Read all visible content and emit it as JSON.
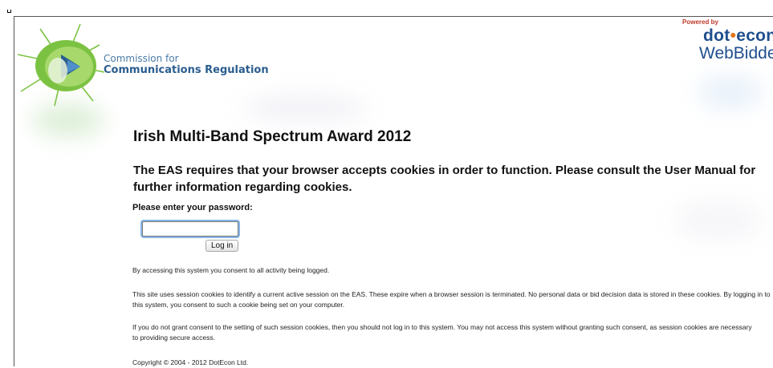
{
  "org": {
    "line1": "Commission for",
    "line2": "Communications Regulation"
  },
  "brand": {
    "powered_by": "Powered by",
    "dot": "dot",
    "econ": "econ",
    "webbidder": "WebBidder"
  },
  "page": {
    "title": "Irish Multi-Band Spectrum Award 2012",
    "cookie_notice": "The EAS requires that your browser accepts cookies in order to function. Please consult the User Manual for further information regarding cookies."
  },
  "form": {
    "password_label": "Please enter your password:",
    "password_value": "",
    "login_label": "Log in"
  },
  "notices": {
    "logging": "By accessing this system you consent to all activity being logged.",
    "session_cookies": "This site uses session cookies to identify a current active session on the EAS. These expire when a browser session is terminated. No personal data or bid decision data is stored in these cookies. By logging in to this system, you consent to such a cookie being set on your computer.",
    "consent": "If you do not grant consent to the setting of such session cookies, then you should not log in to this system. You may not access this system without granting such consent, as session cookies are necessary to providing secure access.",
    "copyright": "Copyright © 2004 - 2012 DotEcon Ltd."
  },
  "colors": {
    "org_blue": "#2a5d8f",
    "brand_blue": "#1f4f8e",
    "brand_orange": "#e2761b",
    "powered_red": "#c0392b",
    "input_focus": "#88b6e8"
  },
  "icons": {
    "logo": "comreg-starburst-logo"
  }
}
